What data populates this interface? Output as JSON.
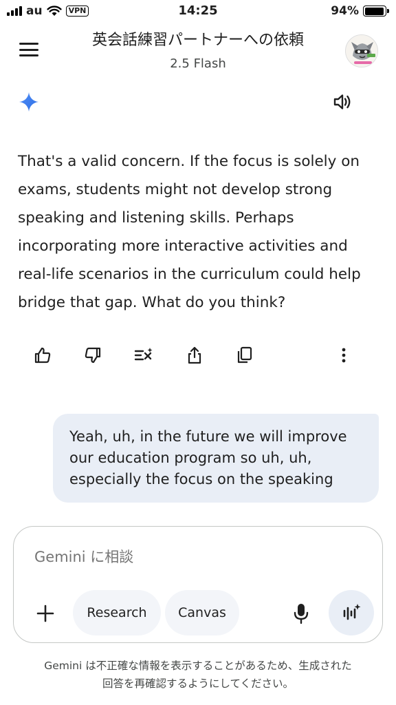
{
  "status_bar": {
    "carrier": "au",
    "vpn": "VPN",
    "time": "14:25",
    "battery": "94%",
    "battery_level": 0.94
  },
  "header": {
    "title": "英会話練習パートナーへの依頼",
    "model": "2.5 Flash",
    "menu_icon": "hamburger-menu-icon",
    "avatar_icon": "profile-avatar-icon"
  },
  "response": {
    "icon": "gemini-sparkle-icon",
    "text": "That's a valid concern. If the focus is solely on exams, students might not develop strong speaking and listening skills. Perhaps incorporating more interactive activities and real-life scenarios in the curriculum could help bridge that gap. What do you think?",
    "actions": [
      "thumbs-up-icon",
      "thumbs-down-icon",
      "modify-response-icon",
      "share-icon",
      "copy-icon",
      "more-options-icon"
    ]
  },
  "user_message": {
    "text": "Yeah, uh, in the future we will improve our education program so uh, uh, especially the focus on the speaking"
  },
  "composer": {
    "placeholder": "Gemini に相談",
    "chips": {
      "research": "Research",
      "canvas": "Canvas"
    }
  },
  "disclaimer": {
    "line1": "Gemini は不正確な情報を表示することがあるため、生成された",
    "line2": "回答を再確認するようにしてください。"
  },
  "colors": {
    "accent": "#4285f4",
    "bubble": "#e9eef6",
    "chip": "#f3f5f9",
    "border": "#c4c7c5"
  }
}
